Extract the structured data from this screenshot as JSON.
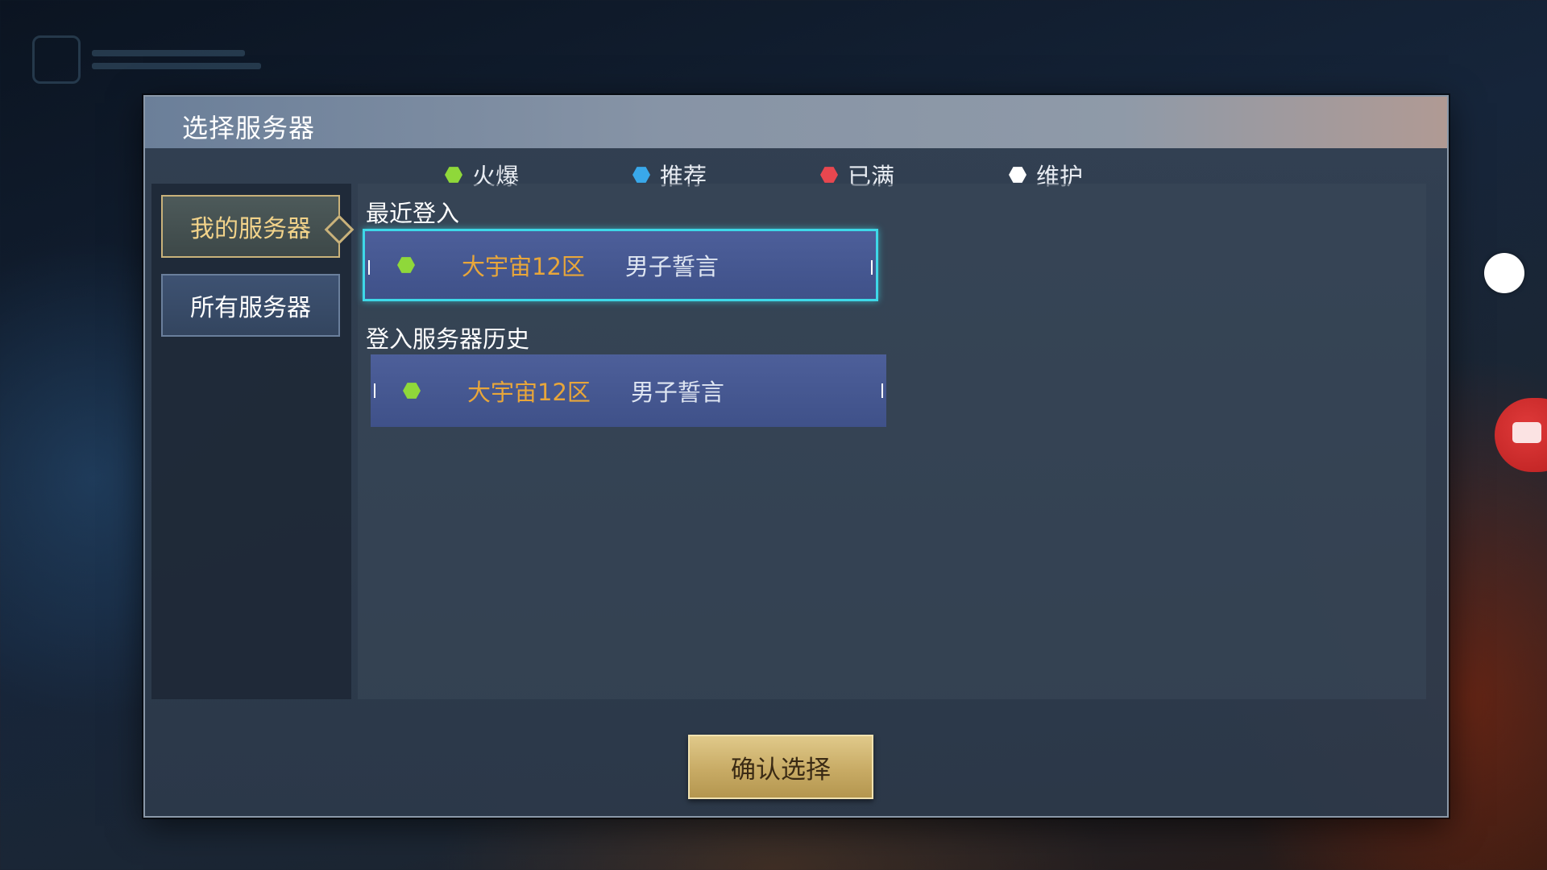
{
  "dialog": {
    "title": "选择服务器"
  },
  "legend": [
    {
      "label": "火爆",
      "color": "#8fd83a"
    },
    {
      "label": "推荐",
      "color": "#39a8ea"
    },
    {
      "label": "已满",
      "color": "#e8474f"
    },
    {
      "label": "维护",
      "color": "#ffffff"
    }
  ],
  "tabs": {
    "my_servers": "我的服务器",
    "all_servers": "所有服务器"
  },
  "recent": {
    "title": "最近登入",
    "server": {
      "name": "大宇宙12区",
      "role": "男子誓言",
      "status": "火爆"
    }
  },
  "history": {
    "title": "登入服务器历史",
    "servers": [
      {
        "name": "大宇宙12区",
        "role": "男子誓言",
        "status": "火爆"
      }
    ]
  },
  "confirm_label": "确认选择"
}
